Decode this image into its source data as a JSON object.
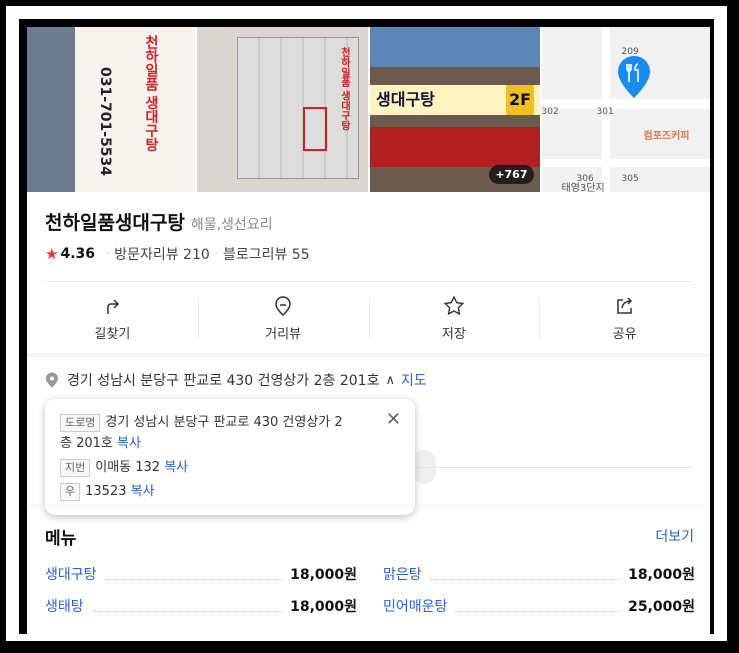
{
  "photos": {
    "photo1": {
      "sign_text": "천하일품 생대구탕",
      "phone": "031-701-5534"
    },
    "photo2": {
      "sign_text": "천하일품 생대구탕"
    },
    "photo3": {
      "banner_text": "생대구탕",
      "floor": "2F",
      "more_count": "+767"
    },
    "photo4": {
      "numbers": [
        "209",
        "302",
        "301",
        "306",
        "305"
      ],
      "cafe_label": "컴포즈커피",
      "apt_label": "태영3단지"
    }
  },
  "place": {
    "name": "천하일품생대구탕",
    "category": "해물,생선요리",
    "rating": "4.36",
    "visitor_reviews": "방문자리뷰 210",
    "blog_reviews": "블로그리뷰 55"
  },
  "actions": [
    {
      "label": "길찾기",
      "icon": "directions-icon"
    },
    {
      "label": "거리뷰",
      "icon": "streetview-icon"
    },
    {
      "label": "저장",
      "icon": "star-icon"
    },
    {
      "label": "공유",
      "icon": "share-icon"
    }
  ],
  "address": {
    "main": "경기 성남시 분당구 판교로 430 건영상가 2층 201호",
    "map_link": "지도",
    "popup": {
      "road_tag": "도로명",
      "road_line1": "경기 성남시 분당구 판교로 430 건영상가 2",
      "road_line2": "층 201호",
      "jibun_tag": "지번",
      "jibun": "이매동 132",
      "zip_tag": "우",
      "zip": "13523",
      "copy_label": "복사"
    }
  },
  "menu": {
    "title": "메뉴",
    "more": "더보기",
    "items": [
      {
        "name": "생대구탕",
        "price": "18,000원"
      },
      {
        "name": "맑은탕",
        "price": "18,000원"
      },
      {
        "name": "생태탕",
        "price": "18,000원"
      },
      {
        "name": "민어매운탕",
        "price": "25,000원"
      }
    ]
  }
}
